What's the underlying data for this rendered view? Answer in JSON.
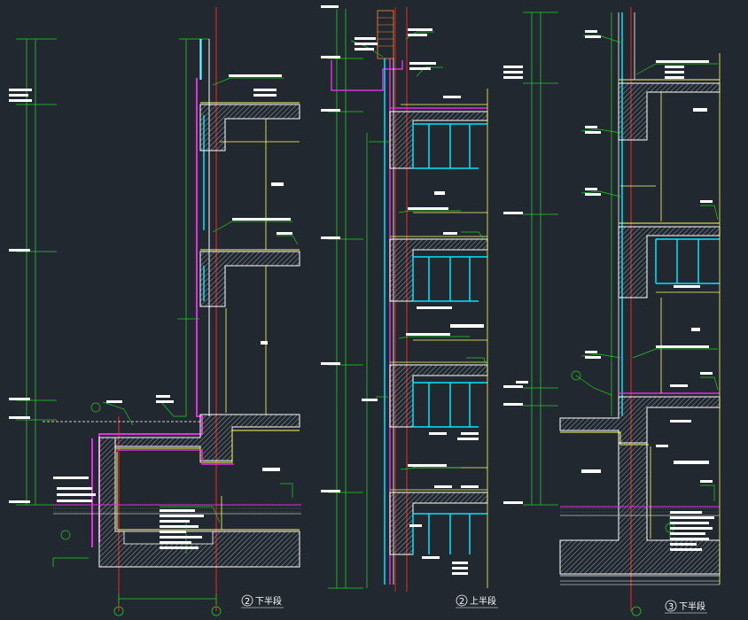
{
  "sections": [
    {
      "num": "2",
      "title": "下半段"
    },
    {
      "num": "2",
      "title": "上半段"
    },
    {
      "num": "3",
      "title": "下半段"
    }
  ],
  "colors": {
    "background": "#212830",
    "wall": "#ffffff",
    "hatch": "#9aa0a6",
    "glass": "#00e5ff",
    "finish": "#e030e0",
    "waterproof": "#ffff66",
    "annotation": "#22cc22",
    "axis": "#ff2222"
  }
}
